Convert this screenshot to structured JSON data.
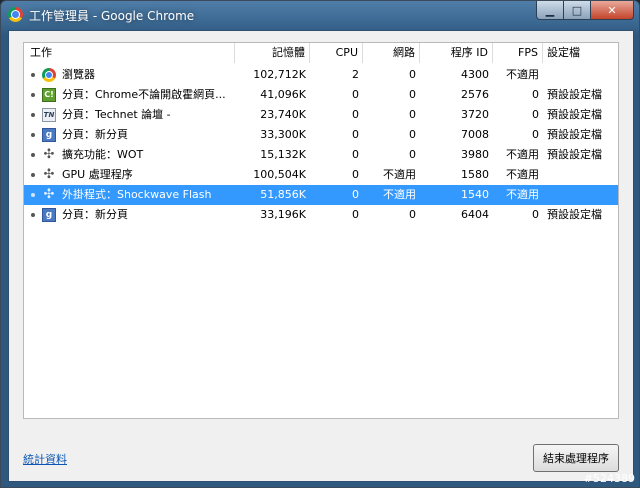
{
  "window": {
    "title": "工作管理員 - Google Chrome"
  },
  "columns": {
    "task": "工作",
    "memory": "記憶體",
    "cpu": "CPU",
    "network": "網路",
    "pid": "程序 ID",
    "fps": "FPS",
    "settings": "設定檔"
  },
  "rows": [
    {
      "icon": "chrome-icon",
      "task": "瀏覽器",
      "memory": "102,712K",
      "cpu": "2",
      "network": "0",
      "pid": "4300",
      "fps": "不適用",
      "settings": ""
    },
    {
      "icon": "chart-icon",
      "task": "分頁：Chrome不論開啟霍網頁...",
      "memory": "41,096K",
      "cpu": "0",
      "network": "0",
      "pid": "2576",
      "fps": "0",
      "settings": "預設設定檔"
    },
    {
      "icon": "technet-icon",
      "task": "分頁：Technet 論壇 -",
      "memory": "23,740K",
      "cpu": "0",
      "network": "0",
      "pid": "3720",
      "fps": "0",
      "settings": "預設設定檔"
    },
    {
      "icon": "google-icon",
      "task": "分頁：新分頁",
      "memory": "33,300K",
      "cpu": "0",
      "network": "0",
      "pid": "7008",
      "fps": "0",
      "settings": "預設設定檔"
    },
    {
      "icon": "puzzle-icon",
      "task": "擴充功能：WOT",
      "memory": "15,132K",
      "cpu": "0",
      "network": "0",
      "pid": "3980",
      "fps": "不適用",
      "settings": "預設設定檔"
    },
    {
      "icon": "puzzle-icon",
      "task": "GPU 處理程序",
      "memory": "100,504K",
      "cpu": "0",
      "network": "不適用",
      "pid": "1580",
      "fps": "不適用",
      "settings": ""
    },
    {
      "icon": "puzzle-icon",
      "task": "外掛程式：Shockwave Flash",
      "memory": "51,856K",
      "cpu": "0",
      "network": "不適用",
      "pid": "1540",
      "fps": "不適用",
      "settings": "",
      "selected": true
    },
    {
      "icon": "google-icon",
      "task": "分頁：新分頁",
      "memory": "33,196K",
      "cpu": "0",
      "network": "0",
      "pid": "6404",
      "fps": "0",
      "settings": "預設設定檔"
    }
  ],
  "footer": {
    "stats_link": "統計資料",
    "end_process_label": "結束處理程序"
  },
  "watermark": "#524389"
}
